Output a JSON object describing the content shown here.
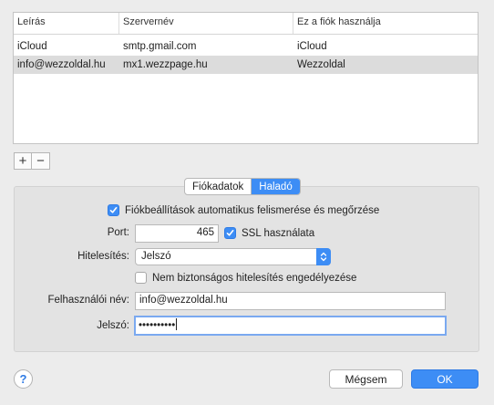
{
  "table": {
    "headers": [
      "Leírás",
      "Szervernév",
      "Ez a fiók használja"
    ],
    "rows": [
      {
        "description": "iCloud",
        "server": "smtp.gmail.com",
        "used_by": "iCloud"
      },
      {
        "description": "info@wezzoldal.hu",
        "server": "mx1.wezzpage.hu",
        "used_by": "Wezzoldal"
      }
    ]
  },
  "list_buttons": {
    "add": "+",
    "remove": "−"
  },
  "tabs": [
    {
      "label": "Fiókadatok",
      "active": false
    },
    {
      "label": "Haladó",
      "active": true
    }
  ],
  "advanced": {
    "auto_detect_label": "Fiókbeállítások automatikus felismerése és megőrzése",
    "auto_detect_checked": true,
    "port_label": "Port:",
    "port_value": "465",
    "ssl_label": "SSL használata",
    "ssl_checked": true,
    "auth_label": "Hitelesítés:",
    "auth_value": "Jelszó",
    "insecure_label": "Nem biztonságos hitelesítés engedélyezése",
    "insecure_checked": false,
    "username_label": "Felhasználói név:",
    "username_value": "info@wezzoldal.hu",
    "password_label": "Jelszó:",
    "password_value": "••••••••••"
  },
  "footer": {
    "help": "?",
    "cancel": "Mégsem",
    "ok": "OK"
  },
  "colors": {
    "accent": "#3d8df5"
  }
}
